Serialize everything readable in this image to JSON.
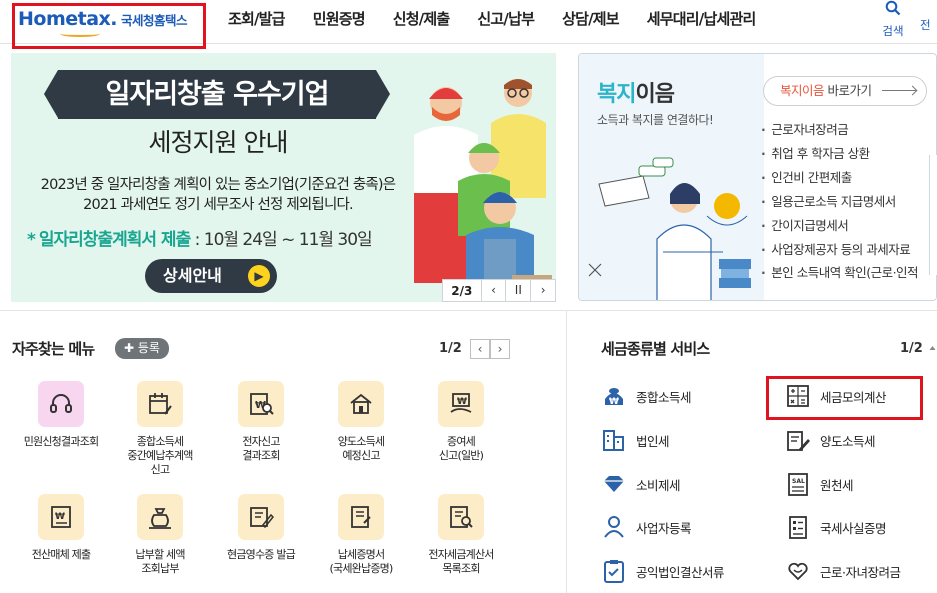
{
  "header": {
    "logo_brand": "Hometax.",
    "logo_sub": "국세청홈택스",
    "nav": [
      "조회/발급",
      "민원증명",
      "신청/제출",
      "신고/납부",
      "상담/제보",
      "세무대리/납세관리"
    ],
    "search_label": "검색",
    "all_menu_label": "전"
  },
  "banner": {
    "title": "일자리창출 우수기업",
    "subtitle": "세정지원 안내",
    "desc_line1": "2023년 중 일자리창출 계획이 있는 중소기업(기준요건 충족)은",
    "desc_line2": "2021 과세연도 정기 세무조사 선정 제외됩니다.",
    "highlight_star": "*",
    "highlight_label": "일자리창출계획서 제출",
    "highlight_period": " : 10월 24일 ~ 11월 30일",
    "detail_button": "상세안내",
    "pager_current": "2/3",
    "pager_prev": "‹",
    "pager_pause": "II",
    "pager_next": "›"
  },
  "promo": {
    "title_a": "복지",
    "title_b": "이음",
    "subtitle": "소득과 복지를 연결하다!",
    "goto_em": "복지이음",
    "goto_rest": " 바로가기",
    "items": [
      "근로자녀장려금",
      "취업 후 학자금 상환",
      "인건비 간편제출",
      "일용근로소득 지급명세서",
      "간이지급명세서",
      "사업장제공자 등의 과세자료",
      "본인 소득내역 확인(근로·인적"
    ]
  },
  "frequent": {
    "title": "자주찾는 메뉴",
    "register": "✚ 등록",
    "page": "1/2",
    "prev": "‹",
    "next": "›",
    "items": [
      "민원신청결과조회",
      "종합소득세\n중간예납추계액\n신고",
      "전자신고\n결과조회",
      "양도소득세\n예정신고",
      "증여세\n신고(일반)",
      "전산매체 제출",
      "납부할 세액\n조회납부",
      "현금영수증 발급",
      "납세증명서\n(국세완납증명)",
      "전자세금계산서\n목록조회"
    ]
  },
  "tax_services": {
    "title": "세금종류별 서비스",
    "page": "1/2",
    "left": [
      "종합소득세",
      "법인세",
      "소비제세",
      "사업자등록",
      "공익법인결산서류"
    ],
    "right": [
      "세금모의계산",
      "양도소득세",
      "원천세",
      "국세사실증명",
      "근로·자녀장려금"
    ]
  },
  "colors": {
    "brand_blue": "#1d5bb8",
    "highlight_red": "#e0141e",
    "banner_bg": "#e3f6ee",
    "banner_accent": "#19a58f",
    "icon_bg": "#fdecc8"
  }
}
